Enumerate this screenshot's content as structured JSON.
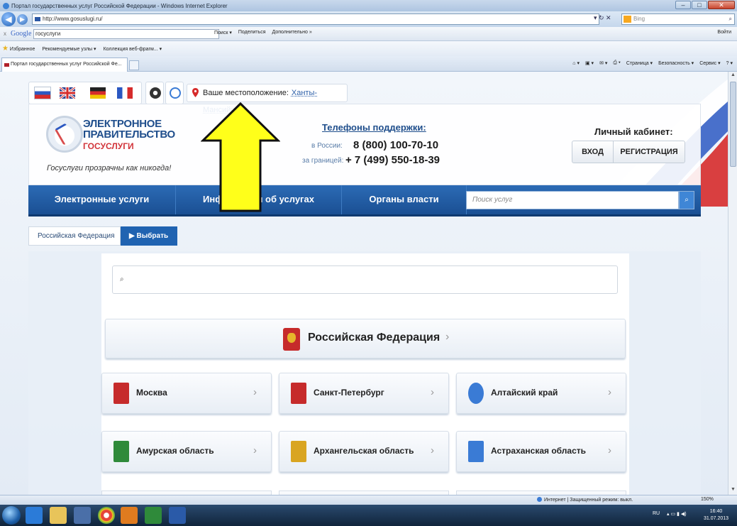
{
  "browser": {
    "window_title": "Портал государственных услуг Российской Федерации - Windows Internet Explorer",
    "url": "http://www.gosuslugi.ru/",
    "bing_placeholder": "Bing",
    "google_label": "Google",
    "google_query": "госуслуги",
    "google_tools": [
      "Поиск ▾",
      "Поделиться",
      "Дополнительно »"
    ],
    "google_signin": "Войти",
    "favorites": [
      "Избранное",
      "Рекомендуемые узлы ▾",
      "Коллекция веб-фрагм... ▾"
    ],
    "tab_title": "Портал государственных услуг Российской Фе...",
    "commands": [
      "Страница ▾",
      "Безопасность ▾",
      "Сервис ▾"
    ],
    "status_zone": "Интернет | Защищенный режим: выкл.",
    "zoom": "150%"
  },
  "site": {
    "location_label": "Ваше местоположение:",
    "location_city": "Ханты-Мансийск",
    "logo_line1": "ЭЛЕКТРОННОЕ",
    "logo_line2": "ПРАВИТЕЛЬСТВО",
    "logo_line3": "ГОСУСЛУГИ",
    "slogan": "Госуслуги прозрачны как никогда!",
    "phones_title": "Телефоны поддержки:",
    "phone_ru_label": "в России:",
    "phone_ru": "8 (800) 100-70-10",
    "phone_abroad_label": "за границей:",
    "phone_abroad": "+ 7 (499) 550-18-39",
    "cabinet_title": "Личный кабинет:",
    "login": "ВХОД",
    "register": "РЕГИСТРАЦИЯ",
    "nav": [
      "Электронные услуги",
      "Информация об услугах",
      "Органы власти"
    ],
    "search_placeholder": "Поиск услуг",
    "breadcrumb_current": "Российская Федерация",
    "breadcrumb_action": "Выбрать",
    "federation": "Российская Федерация",
    "regions": [
      "Москва",
      "Санкт-Петербург",
      "Алтайский край",
      "Амурская область",
      "Архангельская область",
      "Астраханская область"
    ]
  },
  "taskbar": {
    "lang": "RU",
    "time": "16:40",
    "date": "31.07.2013"
  },
  "colors": {
    "nav_blue": "#1f5ca5",
    "accent_red": "#d2343a",
    "arrow_yellow": "#ffff1a"
  }
}
